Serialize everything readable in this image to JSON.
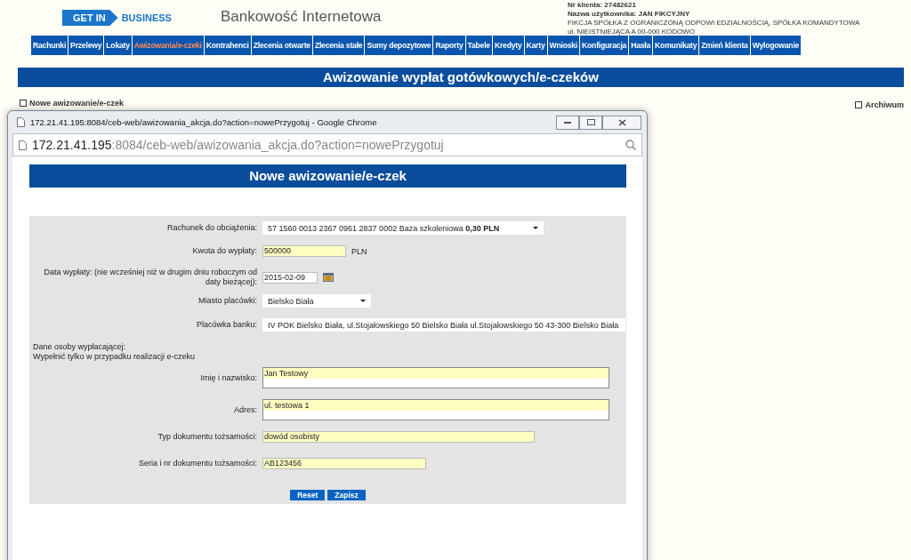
{
  "header": {
    "logo": {
      "left": "GET IN",
      "right": "BUSINESS"
    },
    "title": "Bankowość Internetowa",
    "client_info": [
      {
        "label": "Nr klienta:",
        "value": "27482621"
      },
      {
        "label": "Nazwa użytkownika:",
        "value": "JAN FIKCYJNY"
      }
    ],
    "client_lines": [
      "FIKCJA SPÓŁKA Z OGRANICZONĄ ODPOWI EDZIALNOŚCIĄ, SPÓŁKA KOMANDYTOWA",
      "ul. NIEISTNIEJĄCA A 00-000 KODOWO"
    ]
  },
  "nav": [
    {
      "label": "Rachunki",
      "selected": false
    },
    {
      "label": "Przelewy",
      "selected": false
    },
    {
      "label": "Lokaty",
      "selected": false
    },
    {
      "label": "Awizowania/e-czeki",
      "selected": true
    },
    {
      "label": "Kontrahenci",
      "selected": false
    },
    {
      "label": "Zlecenia otwarte",
      "selected": false
    },
    {
      "label": "Zlecenia stałe",
      "selected": false
    },
    {
      "label": "Sumy depozytowe",
      "selected": false
    },
    {
      "label": "Raporty",
      "selected": false
    },
    {
      "label": "Tabele",
      "selected": false
    },
    {
      "label": "Kredyty",
      "selected": false
    },
    {
      "label": "Karty",
      "selected": false
    },
    {
      "label": "Wnioski",
      "selected": false
    },
    {
      "label": "Konfiguracja",
      "selected": false
    },
    {
      "label": "Hasła",
      "selected": false
    },
    {
      "label": "Komunikaty",
      "selected": false
    },
    {
      "label": "Zmień klienta",
      "selected": false
    },
    {
      "label": "Wylogowanie",
      "selected": false
    }
  ],
  "page_title": "Awizowanie wypłat gotówkowych/e-czeków",
  "links": {
    "new": "Nowe awizowanie/e-czek",
    "archive": "Archiwum"
  },
  "popup": {
    "title": "172.21.41.195:8084/ceb-web/awizowania_akcja.do?action=nowePrzygotuj - Google Chrome",
    "address": {
      "host": "172.21.41.195",
      "path": ":8084/ceb-web/awizowania_akcja.do?action=nowePrzygotuj"
    },
    "heading": "Nowe awizowanie/e-czek",
    "fields": [
      {
        "kind": "select",
        "label": "Rachunek do obciążenia:",
        "value": "57 1560 0013 2367 0961 2837 0002 Baza szkoleniowa **0,30 PLN**"
      },
      {
        "kind": "input",
        "label": "Kwota do wypłaty:",
        "value": "500000",
        "suffix": "PLN"
      },
      {
        "kind": "date",
        "label": "Data wypłaty: (nie wcześniej niż w drugim dniu roboczym od daty bieżącej):",
        "value": "2015-02-09"
      },
      {
        "kind": "select",
        "label": "Miasto placówki:",
        "value": "Bielsko Biała"
      },
      {
        "kind": "select",
        "label": "Placówka banku:",
        "value": "IV POK Bielsko Biała, ul.Stojałowskiego 50 Bielsko Biała ul.Stojałowskiego 50 43-300 Bielsko Biała"
      },
      {
        "kind": "note",
        "lines": [
          "Dane osoby wypłacającej:",
          "Wypełnić tylko w przypadku realizacji e-czeku"
        ]
      },
      {
        "kind": "textarea",
        "label": "Imię i nazwisko:",
        "value": "Jan Testowy"
      },
      {
        "kind": "textarea",
        "label": "Adres:",
        "value": "ul. testowa 1"
      },
      {
        "kind": "input",
        "label": "Typ dokumentu tożsamości:",
        "value": "dowód osobisty"
      },
      {
        "kind": "input",
        "label": "Seria i nr dokumentu tożsamości:",
        "value": "AB123456"
      }
    ],
    "buttons": [
      "Reset",
      "Zapisz"
    ]
  }
}
